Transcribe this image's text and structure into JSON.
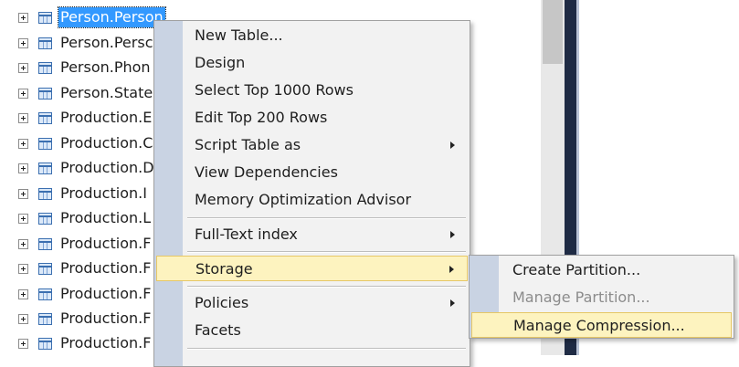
{
  "tree": {
    "items": [
      {
        "label": "Person.Person",
        "selected": true
      },
      {
        "label": "Person.Persc"
      },
      {
        "label": "Person.Phon"
      },
      {
        "label": "Person.State"
      },
      {
        "label": "Production.E"
      },
      {
        "label": "Production.C"
      },
      {
        "label": "Production.D"
      },
      {
        "label": "Production.I"
      },
      {
        "label": "Production.L"
      },
      {
        "label": "Production.F"
      },
      {
        "label": "Production.F"
      },
      {
        "label": "Production.F"
      },
      {
        "label": "Production.F"
      },
      {
        "label": "Production.F"
      }
    ]
  },
  "context_menu": {
    "items": [
      {
        "label": "New Table..."
      },
      {
        "label": "Design"
      },
      {
        "label": "Select Top 1000 Rows"
      },
      {
        "label": "Edit Top 200 Rows"
      },
      {
        "label": "Script Table as",
        "submenu": true
      },
      {
        "label": "View Dependencies"
      },
      {
        "label": "Memory Optimization Advisor"
      },
      {
        "label": "Full-Text index",
        "submenu": true
      },
      {
        "label": "Storage",
        "submenu": true,
        "highlighted": true
      },
      {
        "label": "Policies",
        "submenu": true
      },
      {
        "label": "Facets"
      }
    ]
  },
  "storage_submenu": {
    "items": [
      {
        "label": "Create Partition..."
      },
      {
        "label": "Manage Partition...",
        "disabled": true
      },
      {
        "label": "Manage Compression...",
        "highlighted": true
      }
    ]
  },
  "colors": {
    "selection": "#3399ff",
    "menu_background": "#f2f2f2",
    "menu_gutter": "#c9d3e3",
    "menu_highlight": "#fdf3bf",
    "menu_highlight_border": "#e6c766",
    "pane_separator": "#1f2b44"
  },
  "icons": {
    "expander": "plus-box-icon",
    "table": "table-icon",
    "submenu": "submenu-arrow-icon"
  }
}
